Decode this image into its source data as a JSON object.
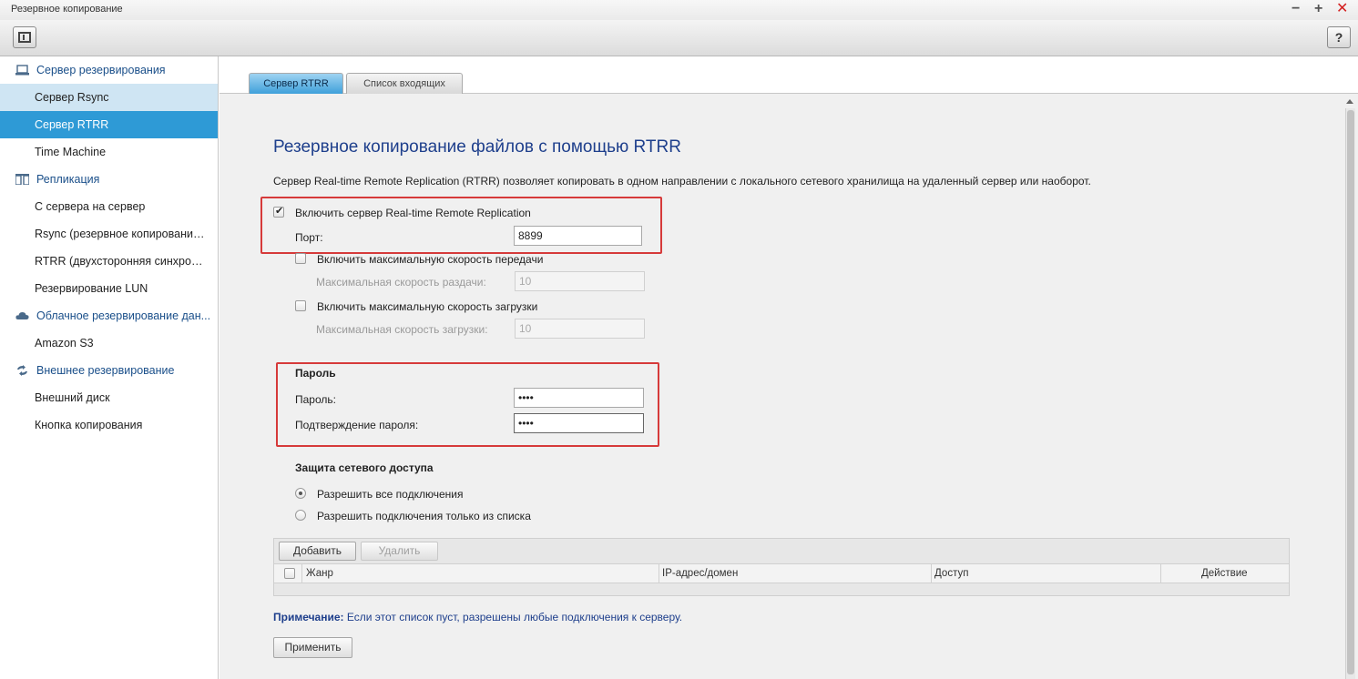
{
  "window": {
    "title": "Резервное копирование",
    "minimize": "−",
    "maximize": "+",
    "close": "✕"
  },
  "toolbar": {
    "help_label": "?"
  },
  "sidebar": {
    "groups": [
      {
        "label": "Сервер резервирования",
        "icon": "server-icon"
      },
      {
        "label": "Репликация",
        "icon": "replication-icon"
      },
      {
        "label": "Облачное резервирование дан...",
        "icon": "cloud-icon"
      },
      {
        "label": "Внешнее резервирование",
        "icon": "sync-arrows-icon"
      }
    ],
    "items": [
      {
        "label": "Сервер Rsync"
      },
      {
        "label": "Сервер RTRR"
      },
      {
        "label": "Time Machine"
      },
      {
        "label": "С сервера на сервер"
      },
      {
        "label": "Rsync (резервное копирование ..."
      },
      {
        "label": "RTRR (двухсторонняя синхрони..."
      },
      {
        "label": "Резервирование LUN"
      },
      {
        "label": "Amazon S3"
      },
      {
        "label": "Внешний диск"
      },
      {
        "label": "Кнопка копирования"
      }
    ]
  },
  "tabs": [
    {
      "label": "Сервер RTRR",
      "active": true
    },
    {
      "label": "Список входящих",
      "active": false
    }
  ],
  "main": {
    "title": "Резервное копирование файлов с помощью RTRR",
    "description": "Сервер Real-time Remote Replication (RTRR) позволяет копировать в одном направлении с локального сетевого хранилища на удаленный сервер или наоборот.",
    "enable_server": {
      "label": "Включить сервер Real-time Remote Replication",
      "checked": true
    },
    "port": {
      "label": "Порт:",
      "value": "8899"
    },
    "max_upload": {
      "label": "Включить максимальную скорость передачи",
      "checked": false
    },
    "max_upload_speed": {
      "label": "Максимальная скорость раздачи:",
      "value": "10"
    },
    "max_download": {
      "label": "Включить максимальную скорость загрузки",
      "checked": false
    },
    "max_download_speed": {
      "label": "Максимальная скорость загрузки:",
      "value": "10"
    },
    "password_section": {
      "heading": "Пароль",
      "password_label": "Пароль:",
      "password_value": "••••",
      "confirm_label": "Подтверждение пароля:",
      "confirm_value": "••••"
    },
    "network_section": {
      "heading": "Защита сетевого доступа",
      "allow_all": {
        "label": "Разрешить все подключения",
        "selected": true
      },
      "allow_list": {
        "label": "Разрешить подключения только из списка",
        "selected": false
      }
    },
    "list": {
      "add_label": "Добавить",
      "delete_label": "Удалить",
      "columns": [
        "Жанр",
        "IP-адрес/домен",
        "Доступ",
        "Действие"
      ]
    },
    "note": {
      "prefix": "Примечание:",
      "text": " Если этот список пуст, разрешены любые подключения к серверу."
    },
    "apply_label": "Применить"
  },
  "colors": {
    "accent": "#2e9ad6",
    "highlight": "#d63a3a",
    "title": "#1e3f8c"
  }
}
